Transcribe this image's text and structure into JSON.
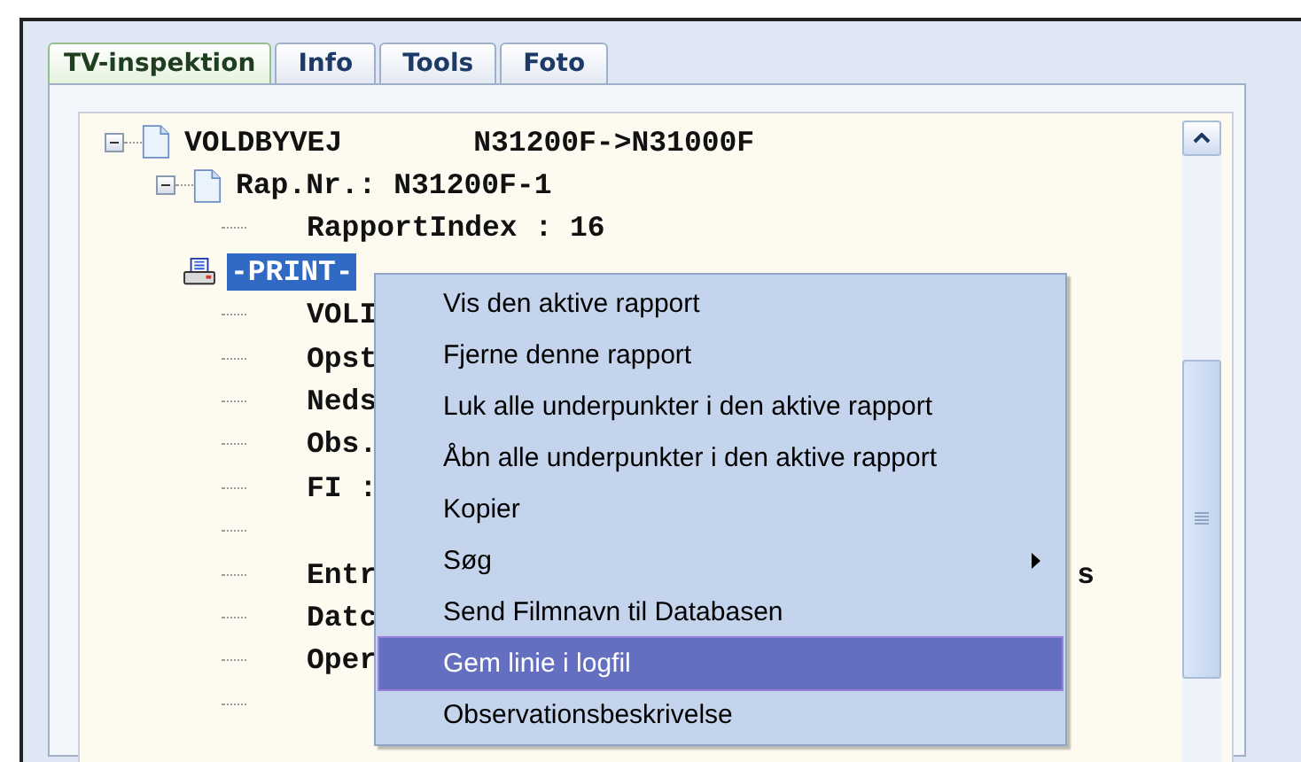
{
  "tabs": [
    {
      "label": "TV-inspektion",
      "selected": true
    },
    {
      "label": "Info",
      "selected": false
    },
    {
      "label": "Tools",
      "selected": false
    },
    {
      "label": "Foto",
      "selected": false
    }
  ],
  "tree": [
    {
      "text": "VOLDBYVEJ",
      "detail": "N31200F->N31000F",
      "expanded": true,
      "kind": "document",
      "children": [
        {
          "text": "Rap.Nr.: N31200F-1",
          "expanded": true,
          "kind": "document",
          "children": [
            {
              "text": "RapportIndex : 16",
              "selected": false
            },
            {
              "text": "-PRINT-",
              "kind": "printer",
              "selected": true
            },
            {
              "text": "VOLI",
              "selected": false
            },
            {
              "text": "Opst",
              "selected": false
            },
            {
              "text": "Neds",
              "selected": false
            },
            {
              "text": "Obs.",
              "selected": false
            },
            {
              "text": "FI :",
              "selected": false
            },
            {
              "kind": "blank"
            },
            {
              "text": "Entr",
              "tail": "s",
              "selected": false
            },
            {
              "text": "Datc",
              "selected": false
            },
            {
              "text": "Oper",
              "selected": false
            },
            {
              "kind": "blank"
            }
          ]
        }
      ]
    }
  ],
  "context_menu": [
    {
      "label": "Vis den aktive rapport",
      "selected": false
    },
    {
      "label": "Fjerne denne rapport",
      "selected": false
    },
    {
      "label": "Luk alle underpunkter i den aktive rapport",
      "selected": false
    },
    {
      "label": "Åbn alle underpunkter i den aktive rapport",
      "selected": false
    },
    {
      "label": "Kopier",
      "selected": false
    },
    {
      "label": "Søg",
      "submenu": true,
      "selected": false
    },
    {
      "label": "Send Filmnavn til Databasen",
      "selected": false
    },
    {
      "label": "Gem linie i logfil",
      "selected": true
    },
    {
      "label": "Observationsbeskrivelse",
      "selected": false
    }
  ]
}
